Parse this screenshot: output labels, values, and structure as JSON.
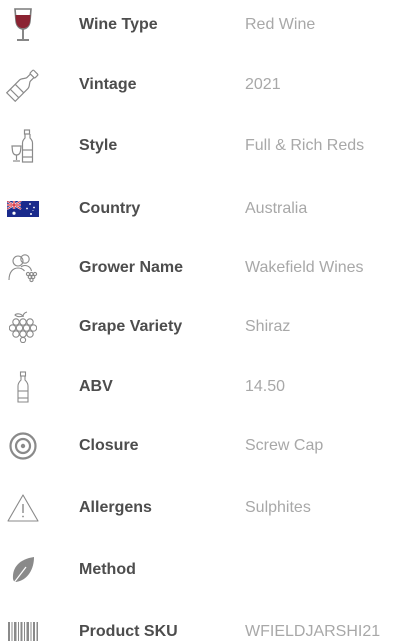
{
  "specs": [
    {
      "icon": "wine-glass-icon",
      "label": "Wine Type",
      "value": "Red Wine"
    },
    {
      "icon": "wine-bottle-icon",
      "label": "Vintage",
      "value": "2021"
    },
    {
      "icon": "bottle-glass-icon",
      "label": "Style",
      "value": "Full & Rich Reds"
    },
    {
      "icon": "australia-flag-icon",
      "label": "Country",
      "value": "Australia"
    },
    {
      "icon": "grower-people-grape-icon",
      "label": "Grower Name",
      "value": "Wakefield Wines"
    },
    {
      "icon": "grape-bunch-icon",
      "label": "Grape Variety",
      "value": "Shiraz"
    },
    {
      "icon": "bottle-outline-icon",
      "label": "ABV",
      "value": "14.50"
    },
    {
      "icon": "screw-cap-target-icon",
      "label": "Closure",
      "value": "Screw Cap"
    },
    {
      "icon": "warning-triangle-icon",
      "label": "Allergens",
      "value": "Sulphites"
    },
    {
      "icon": "leaf-icon",
      "label": "Method",
      "value": ""
    },
    {
      "icon": "barcode-icon",
      "label": "Product SKU",
      "value": "WFIELDJARSHI21"
    }
  ],
  "colors": {
    "label": "#4d4d4d",
    "value": "#a8a8a8",
    "icon": "#8a8a8a",
    "wine": "#8b2332"
  }
}
